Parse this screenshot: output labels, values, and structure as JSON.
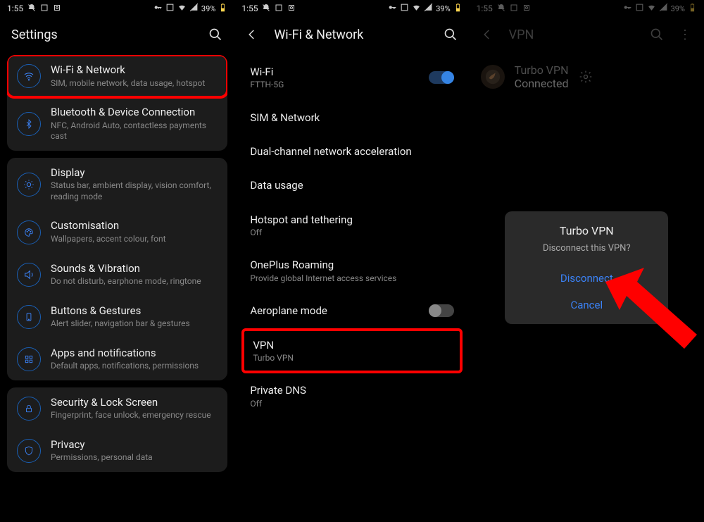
{
  "status": {
    "time": "1:55",
    "battery": "39%"
  },
  "p1": {
    "title": "Settings",
    "groups": [
      [
        {
          "name": "wifi-network",
          "title": "Wi-Fi & Network",
          "sub": "SIM, mobile network, data usage, hotspot",
          "hl": true
        },
        {
          "name": "bluetooth",
          "title": "Bluetooth & Device Connection",
          "sub": "NFC, Android Auto, contactless payments cast"
        }
      ],
      [
        {
          "name": "display",
          "title": "Display",
          "sub": "Status bar, ambient display, vision comfort, reading mode"
        },
        {
          "name": "customisation",
          "title": "Customisation",
          "sub": "Wallpapers, accent colour, font"
        },
        {
          "name": "sounds",
          "title": "Sounds & Vibration",
          "sub": "Do not disturb, earphone mode, ringtone"
        },
        {
          "name": "buttons",
          "title": "Buttons & Gestures",
          "sub": "Alert slider, navigation bar & gestures"
        },
        {
          "name": "apps",
          "title": "Apps and notifications",
          "sub": "Default apps, notifications, permissions"
        }
      ],
      [
        {
          "name": "security",
          "title": "Security & Lock Screen",
          "sub": "Fingerprint, face unlock, emergency rescue"
        },
        {
          "name": "privacy",
          "title": "Privacy",
          "sub": "Permissions, personal data"
        }
      ]
    ]
  },
  "p2": {
    "title": "Wi-Fi & Network",
    "items": [
      {
        "name": "wifi",
        "title": "Wi-Fi",
        "sub": "FTTH-5G",
        "toggle": "on"
      },
      {
        "name": "sim",
        "title": "SIM & Network"
      },
      {
        "name": "dualchannel",
        "title": "Dual-channel network acceleration"
      },
      {
        "name": "datausage",
        "title": "Data usage"
      },
      {
        "name": "hotspot",
        "title": "Hotspot and tethering",
        "sub": "Off"
      },
      {
        "name": "roaming",
        "title": "OnePlus Roaming",
        "sub": "Provide global Internet access services"
      },
      {
        "name": "aeroplane",
        "title": "Aeroplane mode",
        "toggle": "off"
      },
      {
        "name": "vpn",
        "title": "VPN",
        "sub": "Turbo VPN",
        "hl": true
      },
      {
        "name": "dns",
        "title": "Private DNS",
        "sub": "Off"
      }
    ]
  },
  "p3": {
    "title": "VPN",
    "row": {
      "title": "Turbo VPN",
      "sub": "Connected"
    },
    "dialog": {
      "title": "Turbo VPN",
      "msg": "Disconnect this VPN?",
      "btn1": "Disconnect",
      "btn2": "Cancel"
    }
  }
}
